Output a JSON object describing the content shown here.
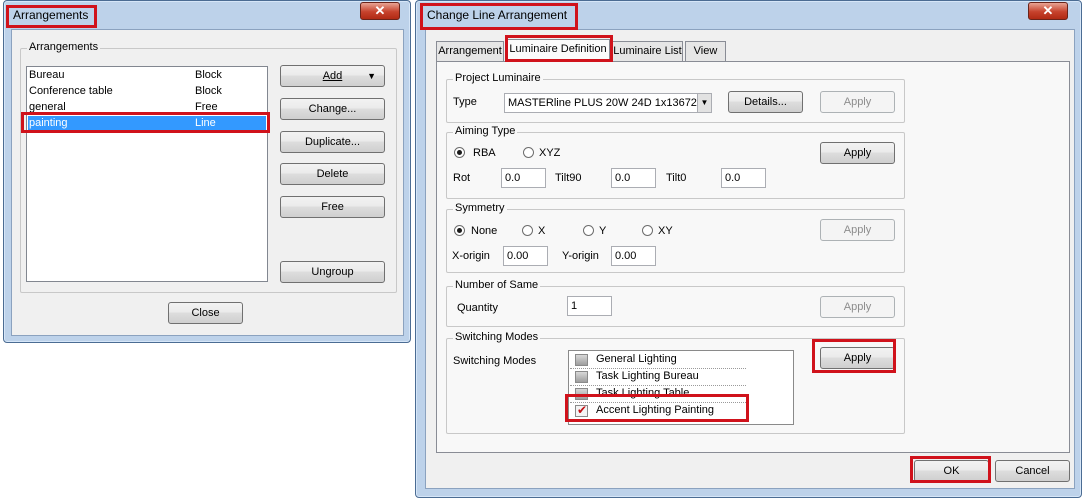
{
  "left_window": {
    "title": "Arrangements",
    "close_glyph": "✕",
    "group_label": "Arrangements",
    "items": [
      {
        "name": "Bureau",
        "type": "Block"
      },
      {
        "name": "Conference table",
        "type": "Block"
      },
      {
        "name": "general",
        "type": "Free"
      },
      {
        "name": "painting",
        "type": "Line"
      }
    ],
    "selected_index": 3,
    "buttons": {
      "add": "Add",
      "change": "Change...",
      "duplicate": "Duplicate...",
      "delete": "Delete",
      "free": "Free",
      "ungroup": "Ungroup",
      "close": "Close"
    }
  },
  "right_window": {
    "title": "Change Line Arrangement",
    "close_glyph": "✕",
    "tabs": [
      "Arrangement",
      "Luminaire Definition",
      "Luminaire List",
      "View"
    ],
    "active_tab": 1,
    "project_luminaire": {
      "group_label": "Project Luminaire",
      "type_label": "Type",
      "type_value": "MASTERline PLUS 20W 24D 1x13672",
      "details_button": "Details...",
      "apply_button": "Apply"
    },
    "aiming_type": {
      "group_label": "Aiming Type",
      "options": [
        "RBA",
        "XYZ"
      ],
      "selected": "RBA",
      "rot_label": "Rot",
      "rot_value": "0.0",
      "tilt90_label": "Tilt90",
      "tilt90_value": "0.0",
      "tilt0_label": "Tilt0",
      "tilt0_value": "0.0",
      "apply_button": "Apply"
    },
    "symmetry": {
      "group_label": "Symmetry",
      "options": [
        "None",
        "X",
        "Y",
        "XY"
      ],
      "selected": "None",
      "xorigin_label": "X-origin",
      "xorigin_value": "0.00",
      "yorigin_label": "Y-origin",
      "yorigin_value": "0.00",
      "apply_button": "Apply"
    },
    "number_of_same": {
      "group_label": "Number of Same",
      "quantity_label": "Quantity",
      "quantity_value": "1",
      "apply_button": "Apply"
    },
    "switching_modes": {
      "group_label": "Switching Modes",
      "row_label": "Switching Modes",
      "items": [
        {
          "label": "General Lighting",
          "checked": false
        },
        {
          "label": "Task Lighting Bureau",
          "checked": false
        },
        {
          "label": "Task Lighting Table",
          "checked": false
        },
        {
          "label": "Accent Lighting Painting",
          "checked": true
        }
      ],
      "apply_button": "Apply"
    },
    "ok_button": "OK",
    "cancel_button": "Cancel"
  },
  "colors": {
    "highlight_red": "#d0121b",
    "selection_blue": "#3399ff",
    "window_frame": "#bdd2ea"
  }
}
